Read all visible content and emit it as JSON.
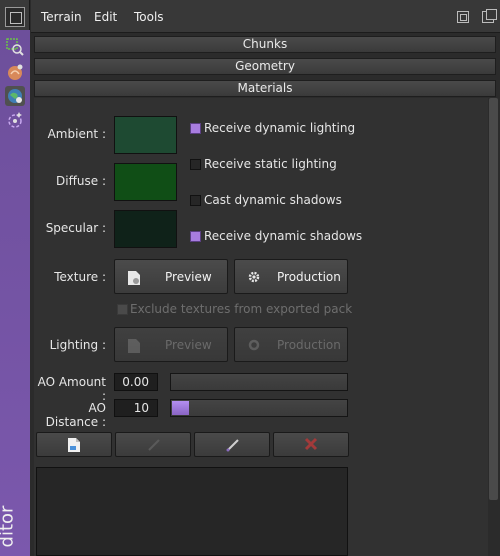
{
  "menu": {
    "items": [
      "Terrain",
      "Edit",
      "Tools"
    ]
  },
  "sidebar": {
    "editor_label": "ditor"
  },
  "sections": {
    "chunks": "Chunks",
    "geometry": "Geometry",
    "materials": "Materials"
  },
  "materials": {
    "ambient_label": "Ambient :",
    "diffuse_label": "Diffuse :",
    "specular_label": "Specular :",
    "ambient_color": "#1e4a32",
    "diffuse_color": "#104e16",
    "specular_color": "#0f2219",
    "checks": [
      {
        "label": "Receive dynamic lighting",
        "checked": true
      },
      {
        "label": "Receive static lighting",
        "checked": false
      },
      {
        "label": "Cast dynamic shadows",
        "checked": false
      },
      {
        "label": "Receive dynamic shadows",
        "checked": true
      }
    ],
    "texture_label": "Texture :",
    "preview_label": "Preview",
    "production_label": "Production",
    "exclude_label": "Exclude textures from exported pack",
    "lighting_label": "Lighting :",
    "lighting_preview_label": "Preview",
    "lighting_production_label": "Production",
    "ao_amount_label": "AO Amount :",
    "ao_amount_value": "0.00",
    "ao_amount_fraction": 0.0,
    "ao_distance_label": "AO Distance :",
    "ao_distance_value": "10",
    "ao_distance_fraction": 0.1
  },
  "colors": {
    "accent": "#7b58ad",
    "check_on": "#a87de0",
    "delete": "#c0392b"
  },
  "icons": [
    "new-document-icon",
    "brush-disabled-icon",
    "brush-icon",
    "delete-icon"
  ]
}
